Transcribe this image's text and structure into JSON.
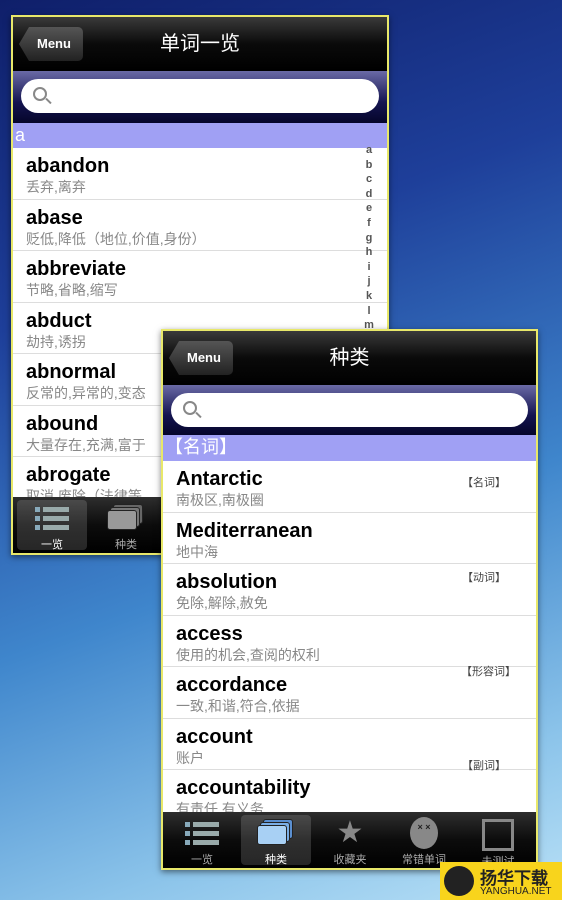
{
  "list_panel": {
    "menu_label": "Menu",
    "title": "单词一览",
    "search_placeholder": "",
    "section": "a",
    "index": [
      "a",
      "b",
      "c",
      "d",
      "e",
      "f",
      "g",
      "h",
      "i",
      "j",
      "k",
      "l",
      "m"
    ],
    "rows": [
      {
        "word": "abandon",
        "meaning": "丢弃,离弃"
      },
      {
        "word": "abase",
        "meaning": "贬低,降低（地位,价值,身份）"
      },
      {
        "word": "abbreviate",
        "meaning": "节略,省略,缩写"
      },
      {
        "word": "abduct",
        "meaning": "劫持,诱拐"
      },
      {
        "word": "abnormal",
        "meaning": "反常的,异常的,变态"
      },
      {
        "word": "abound",
        "meaning": "大量存在,充满,富于"
      },
      {
        "word": "abrogate",
        "meaning": "取消,废除（法律等"
      }
    ],
    "tabs": [
      {
        "label": "一览",
        "icon": "list-icon",
        "selected": true
      },
      {
        "label": "种类",
        "icon": "cards-icon",
        "selected": false
      }
    ]
  },
  "category_panel": {
    "menu_label": "Menu",
    "title": "种类",
    "search_placeholder": "",
    "section": "【名词】",
    "index_tags": [
      "【名词】",
      "【动词】",
      "【形容词】",
      "【副词】"
    ],
    "rows": [
      {
        "word": "Antarctic",
        "meaning": "南极区,南极圈"
      },
      {
        "word": "Mediterranean",
        "meaning": "地中海"
      },
      {
        "word": "absolution",
        "meaning": "免除,解除,赦免"
      },
      {
        "word": "access",
        "meaning": "使用的机会,查阅的权利"
      },
      {
        "word": "accordance",
        "meaning": "一致,和谐,符合,依据"
      },
      {
        "word": "account",
        "meaning": "账户"
      },
      {
        "word": "accountability",
        "meaning": "有责任,有义务"
      }
    ],
    "tabs": [
      {
        "label": "一览",
        "icon": "list-icon"
      },
      {
        "label": "种类",
        "icon": "cards-icon",
        "selected": true
      },
      {
        "label": "收藏夹",
        "icon": "star-icon"
      },
      {
        "label": "常错单词",
        "icon": "dizzy-face-icon"
      },
      {
        "label": "未测试",
        "icon": "test-edit-icon"
      }
    ]
  },
  "watermark": {
    "text": "扬华下载",
    "url_text": "YANGHUA.NET"
  }
}
